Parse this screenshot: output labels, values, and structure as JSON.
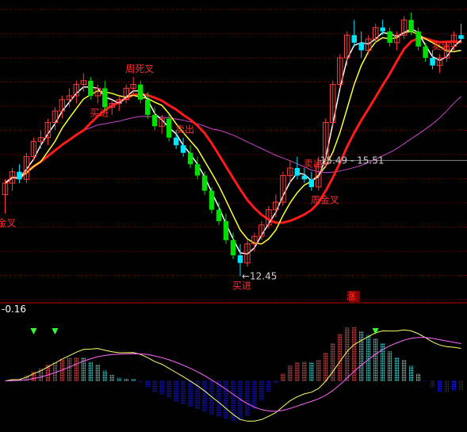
{
  "colors": {
    "background": "#000000",
    "grid": "#8b0000",
    "up_candle": "#ff3b3b",
    "down_candle": "#00e5ff",
    "down_candle_deep": "#00e000",
    "ma_fast": "#ffffff",
    "ma_mid": "#ffff33",
    "ma_slow": "#ff1a1a",
    "ma_long": "#cc44cc",
    "signal_text": "#ff3030",
    "callout_text": "#cfcfcf",
    "macd_pos": "#ff6666",
    "macd_neg": "#1c1cff",
    "macd_dif": "#ffff66",
    "macd_dea": "#ff66ff",
    "macd_light": "#66ffff",
    "arrow": "#33ff33"
  },
  "chart_data": [
    {
      "type": "candlestick",
      "panel": "price",
      "grid": true,
      "ohlc": [
        [
          14.6,
          15.0,
          14.1,
          14.9
        ],
        [
          14.9,
          15.3,
          14.7,
          15.2
        ],
        [
          15.2,
          15.4,
          14.9,
          15.0
        ],
        [
          15.0,
          15.7,
          14.9,
          15.6
        ],
        [
          15.6,
          16.1,
          15.5,
          16.0
        ],
        [
          16.0,
          16.3,
          15.8,
          16.1
        ],
        [
          16.1,
          16.6,
          15.9,
          16.5
        ],
        [
          16.5,
          16.9,
          16.3,
          16.8
        ],
        [
          16.8,
          17.2,
          16.6,
          17.1
        ],
        [
          17.1,
          17.4,
          16.9,
          17.2
        ],
        [
          17.2,
          17.6,
          17.0,
          17.5
        ],
        [
          17.5,
          17.8,
          17.3,
          17.6
        ],
        [
          17.6,
          17.7,
          17.1,
          17.2
        ],
        [
          17.2,
          17.5,
          17.0,
          17.4
        ],
        [
          17.4,
          17.6,
          16.8,
          16.9
        ],
        [
          16.9,
          17.1,
          16.7,
          17.0
        ],
        [
          17.0,
          17.2,
          16.8,
          17.1
        ],
        [
          17.1,
          17.5,
          17.0,
          17.4
        ],
        [
          17.4,
          17.7,
          17.2,
          17.5
        ],
        [
          17.5,
          17.6,
          17.0,
          17.1
        ],
        [
          17.1,
          17.3,
          16.6,
          16.7
        ],
        [
          16.7,
          16.9,
          16.3,
          16.4
        ],
        [
          16.4,
          16.7,
          16.2,
          16.6
        ],
        [
          16.6,
          16.7,
          16.0,
          16.1
        ],
        [
          16.1,
          16.3,
          15.8,
          15.9
        ],
        [
          15.9,
          16.1,
          15.6,
          15.7
        ],
        [
          15.7,
          15.9,
          15.3,
          15.4
        ],
        [
          15.4,
          15.6,
          15.0,
          15.1
        ],
        [
          15.1,
          15.2,
          14.6,
          14.7
        ],
        [
          14.7,
          14.8,
          14.1,
          14.2
        ],
        [
          14.2,
          14.4,
          13.8,
          13.9
        ],
        [
          13.9,
          14.1,
          13.3,
          13.4
        ],
        [
          13.4,
          13.6,
          12.9,
          13.0
        ],
        [
          13.0,
          13.3,
          12.45,
          12.8
        ],
        [
          12.8,
          13.4,
          12.7,
          13.3
        ],
        [
          13.3,
          13.6,
          13.1,
          13.5
        ],
        [
          13.5,
          13.9,
          13.4,
          13.8
        ],
        [
          13.8,
          14.3,
          13.7,
          14.2
        ],
        [
          14.2,
          14.6,
          14.0,
          14.4
        ],
        [
          14.4,
          15.2,
          14.3,
          15.1
        ],
        [
          15.1,
          15.5,
          14.9,
          15.3
        ],
        [
          15.3,
          15.6,
          15.0,
          15.1
        ],
        [
          15.1,
          15.3,
          14.9,
          15.0
        ],
        [
          15.0,
          15.2,
          14.7,
          14.8
        ],
        [
          14.8,
          15.6,
          14.7,
          15.4
        ],
        [
          15.4,
          16.6,
          15.3,
          16.5
        ],
        [
          16.5,
          17.6,
          16.4,
          17.5
        ],
        [
          17.5,
          18.3,
          17.4,
          18.2
        ],
        [
          18.2,
          18.9,
          18.0,
          18.8
        ],
        [
          18.8,
          19.2,
          18.5,
          18.6
        ],
        [
          18.6,
          18.9,
          18.2,
          18.4
        ],
        [
          18.4,
          18.8,
          18.3,
          18.7
        ],
        [
          18.7,
          19.1,
          18.6,
          19.0
        ],
        [
          19.0,
          19.2,
          18.8,
          18.9
        ],
        [
          18.9,
          19.0,
          18.5,
          18.6
        ],
        [
          18.6,
          18.9,
          18.4,
          18.8
        ],
        [
          18.8,
          19.3,
          18.7,
          19.2
        ],
        [
          19.2,
          19.4,
          18.8,
          18.9
        ],
        [
          18.9,
          19.0,
          18.4,
          18.5
        ],
        [
          18.5,
          18.6,
          18.1,
          18.2
        ],
        [
          18.2,
          18.4,
          17.9,
          18.0
        ],
        [
          18.0,
          18.3,
          17.8,
          18.2
        ],
        [
          18.2,
          18.6,
          18.1,
          18.5
        ],
        [
          18.5,
          18.9,
          18.4,
          18.8
        ],
        [
          18.8,
          19.1,
          18.6,
          18.7
        ]
      ],
      "annotations": [
        {
          "text": "金叉",
          "kind": "golden-cross",
          "bar": 0
        },
        {
          "text": "买进",
          "kind": "buy",
          "bar": 13
        },
        {
          "text": "周死叉",
          "kind": "weekly-dead-cross",
          "bar": 18
        },
        {
          "text": "卖出",
          "kind": "sell",
          "bar": 25
        },
        {
          "text": "买进",
          "kind": "buy",
          "bar": 33
        },
        {
          "text": "周金叉",
          "kind": "weekly-golden-cross",
          "bar": 44
        },
        {
          "text": "卖出",
          "kind": "sell",
          "bar": 43
        },
        {
          "text": "卖出",
          "kind": "sell",
          "bar": 61
        },
        {
          "text": "涨",
          "kind": "up-marker",
          "bar": 49
        }
      ],
      "price_callouts": [
        {
          "text": "←12.45",
          "value": 12.45,
          "bar": 33
        },
        {
          "text": "15.49 - 15.51",
          "value": 15.5,
          "bar": 44
        }
      ],
      "y_range": [
        12.0,
        19.6
      ]
    },
    {
      "type": "bar",
      "panel": "macd",
      "title": "-0.16",
      "grid": false
    }
  ]
}
